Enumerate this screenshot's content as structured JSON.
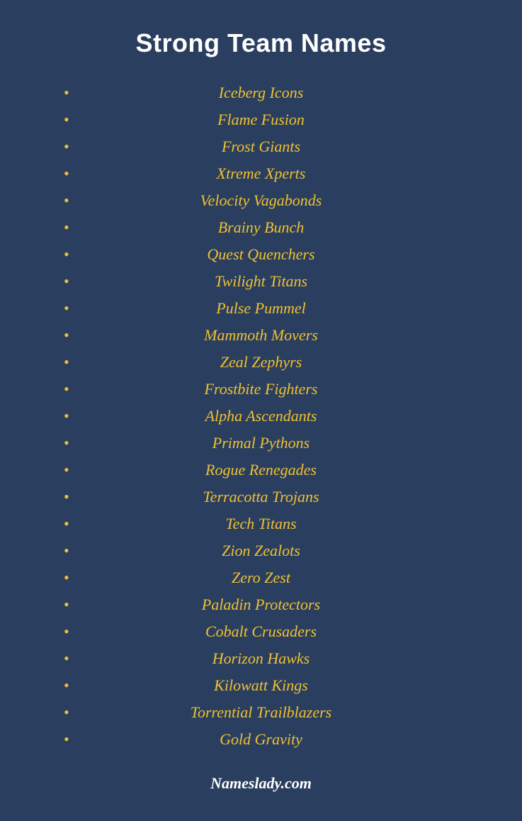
{
  "page": {
    "title": "Strong Team Names",
    "footer": "Nameslady.com",
    "team_names": [
      "Iceberg Icons",
      "Flame Fusion",
      "Frost Giants",
      "Xtreme Xperts",
      "Velocity Vagabonds",
      "Brainy Bunch",
      "Quest Quenchers",
      "Twilight Titans",
      "Pulse Pummel",
      "Mammoth Movers",
      "Zeal Zephyrs",
      "Frostbite Fighters",
      "Alpha Ascendants",
      "Primal Pythons",
      "Rogue Renegades",
      "Terracotta Trojans",
      "Tech Titans",
      "Zion Zealots",
      "Zero Zest",
      "Paladin Protectors",
      "Cobalt Crusaders",
      "Horizon Hawks",
      "Kilowatt Kings",
      "Torrential Trailblazers",
      "Gold Gravity"
    ]
  }
}
